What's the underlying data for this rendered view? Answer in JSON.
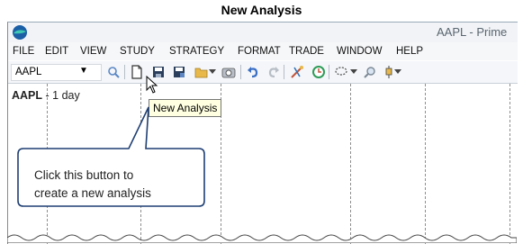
{
  "doc_title": "New Analysis",
  "window": {
    "title": "AAPL - Prime"
  },
  "menu": [
    "FILE",
    "EDIT",
    "VIEW",
    "STUDY",
    "STRATEGY",
    "FORMAT",
    "TRADE",
    "WINDOW",
    "HELP"
  ],
  "symbol_box": {
    "value": "AAPL"
  },
  "chart": {
    "symbol": "AAPL",
    "interval": " - 1 day"
  },
  "tooltip": "New Analysis",
  "callout": {
    "line1": "Click this button to",
    "line2": "create a new analysis"
  },
  "colors": {
    "callout_border": "#1f3f73",
    "accent": "#2f6fb4"
  }
}
